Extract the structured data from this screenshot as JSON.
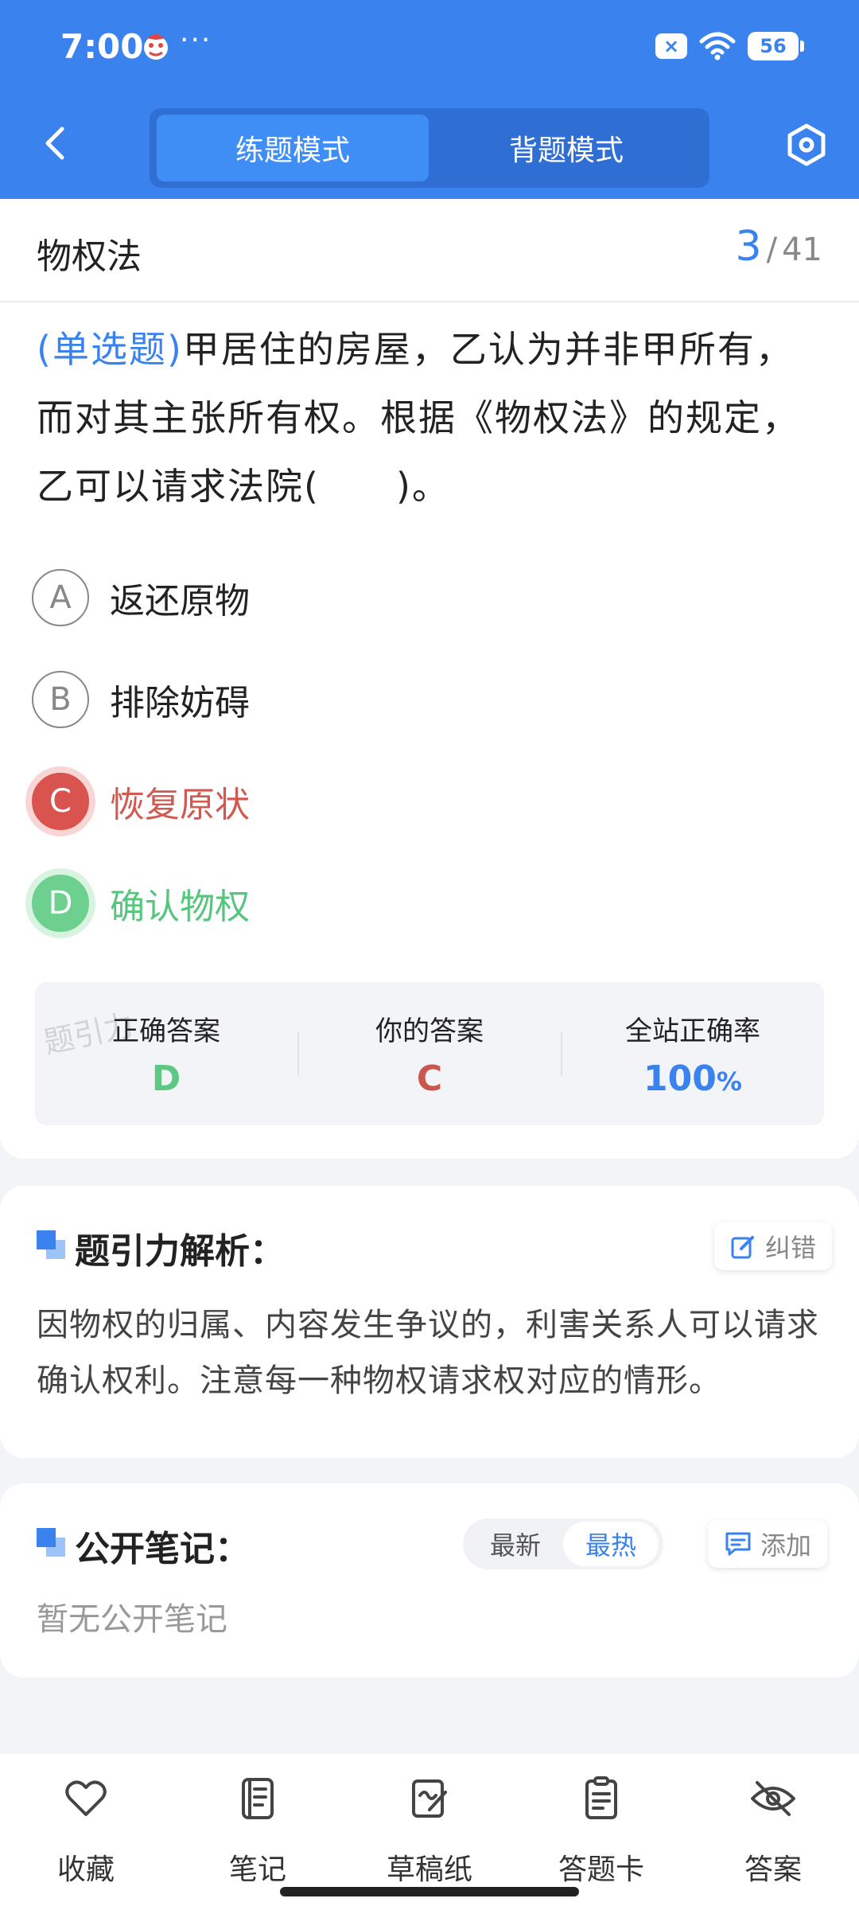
{
  "status_bar": {
    "time": "7:00",
    "more": "···",
    "battery": "56",
    "close_badge": "×"
  },
  "nav": {
    "tabs": [
      {
        "label": "练题模式",
        "active": true
      },
      {
        "label": "背题模式",
        "active": false
      }
    ],
    "back_icon": "chevron-left-icon",
    "settings_icon": "hexagon-settings-icon"
  },
  "question": {
    "chapter": "物权法",
    "current": "3",
    "total": "41",
    "type": "(单选题)",
    "text": "甲居住的房屋，乙认为并非甲所有，而对其主张所有权。根据《物权法》的规定，乙可以请求法院(　　)。",
    "options": [
      {
        "letter": "A",
        "text": "返还原物",
        "state": "normal"
      },
      {
        "letter": "B",
        "text": "排除妨碍",
        "state": "normal"
      },
      {
        "letter": "C",
        "text": "恢复原状",
        "state": "wrong"
      },
      {
        "letter": "D",
        "text": "确认物权",
        "state": "correct"
      }
    ]
  },
  "stats": {
    "watermark": "题引力",
    "correct_label": "正确答案",
    "correct_value": "D",
    "yours_label": "你的答案",
    "yours_value": "C",
    "rate_label": "全站正确率",
    "rate_value": "100",
    "rate_unit": "%",
    "colors": {
      "correct": "#5cc884",
      "wrong": "#c9574f",
      "accent": "#3a82ee"
    }
  },
  "analysis": {
    "title": "题引力解析：",
    "report_label": "纠错",
    "text": "因物权的归属、内容发生争议的，利害关系人可以请求确认权利。注意每一种物权请求权对应的情形。"
  },
  "notes": {
    "title": "公开笔记：",
    "sort_newest": "最新",
    "sort_hottest": "最热",
    "add_label": "添加",
    "empty": "暂无公开笔记"
  },
  "bottom_bar": {
    "items": [
      {
        "label": "收藏",
        "icon": "heart-icon"
      },
      {
        "label": "笔记",
        "icon": "notebook-icon"
      },
      {
        "label": "草稿纸",
        "icon": "draft-paper-icon"
      },
      {
        "label": "答题卡",
        "icon": "answer-sheet-icon"
      },
      {
        "label": "答案",
        "icon": "eye-off-icon"
      }
    ]
  }
}
